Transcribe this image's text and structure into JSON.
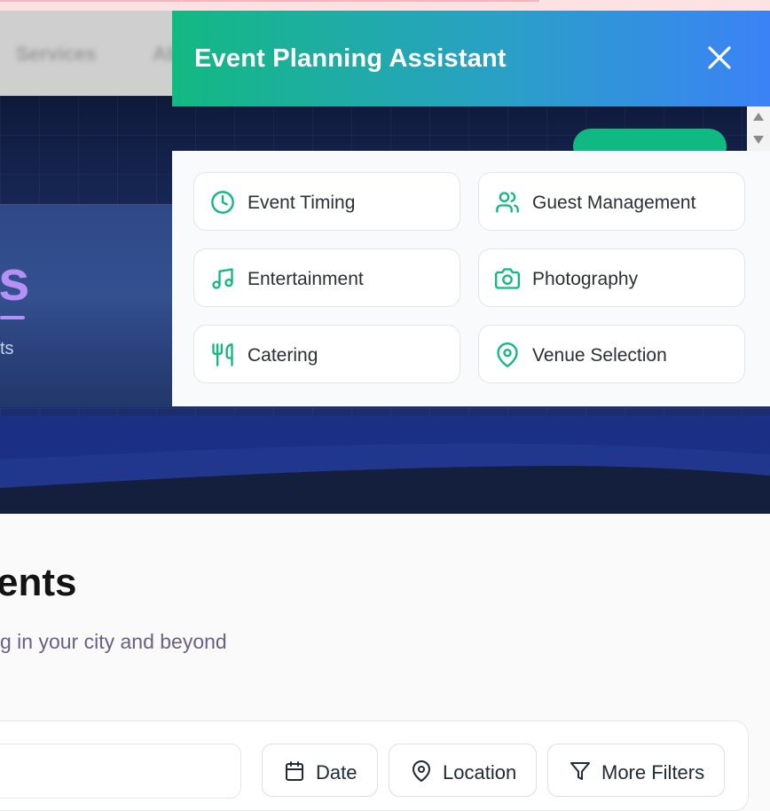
{
  "site_nav": {
    "items": [
      "Services",
      "Ab"
    ]
  },
  "hero": {
    "word": "s",
    "subtitle": "ts"
  },
  "assistant_panel": {
    "title": "Event Planning Assistant",
    "options": [
      {
        "label": "Event Timing",
        "icon": "clock-icon"
      },
      {
        "label": "Guest Management",
        "icon": "users-icon"
      },
      {
        "label": "Entertainment",
        "icon": "music-icon"
      },
      {
        "label": "Photography",
        "icon": "camera-icon"
      },
      {
        "label": "Catering",
        "icon": "utensils-icon"
      },
      {
        "label": "Venue Selection",
        "icon": "map-pin-icon"
      }
    ]
  },
  "events_section": {
    "title": "ents",
    "subtitle": "g in your city and beyond"
  },
  "filters": {
    "date_label": "Date",
    "location_label": "Location",
    "more_label": "More Filters"
  },
  "colors": {
    "accent_green": "#10b981",
    "accent_blue": "#3b82f6",
    "hero_purple": "#b691f5"
  }
}
